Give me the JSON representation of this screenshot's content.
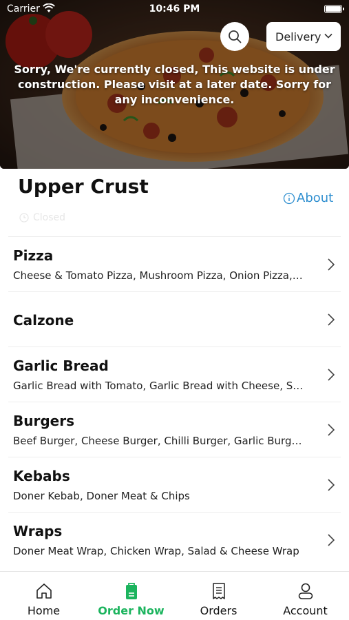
{
  "status_bar": {
    "carrier": "Carrier",
    "time": "10:46 PM"
  },
  "header": {
    "delivery_label": "Delivery",
    "closed_message": "Sorry, We're currently closed, This website is under construction. Please visit at a later date. Sorry for any inconvenience."
  },
  "store": {
    "title": "Upper Crust",
    "about_label": "About",
    "status_label": "Closed"
  },
  "menu": [
    {
      "name": "Pizza",
      "desc": "Cheese & Tomato Pizza, Mushroom Pizza, Onion Pizza,…"
    },
    {
      "name": "Calzone",
      "desc": ""
    },
    {
      "name": "Garlic Bread",
      "desc": "Garlic Bread with Tomato, Garlic Bread with Cheese, S…"
    },
    {
      "name": "Burgers",
      "desc": "Beef Burger, Cheese Burger, Chilli Burger, Garlic Burg…"
    },
    {
      "name": "Kebabs",
      "desc": "Doner Kebab, Doner Meat & Chips"
    },
    {
      "name": "Wraps",
      "desc": "Doner Meat Wrap, Chicken Wrap, Salad & Cheese Wrap"
    }
  ],
  "tabs": [
    {
      "label": "Home",
      "icon": "home-icon"
    },
    {
      "label": "Order Now",
      "icon": "order-bag-icon"
    },
    {
      "label": "Orders",
      "icon": "receipt-icon"
    },
    {
      "label": "Account",
      "icon": "person-icon"
    }
  ],
  "colors": {
    "accent_green": "#1cb45e",
    "link_blue": "#2f8fd0"
  }
}
